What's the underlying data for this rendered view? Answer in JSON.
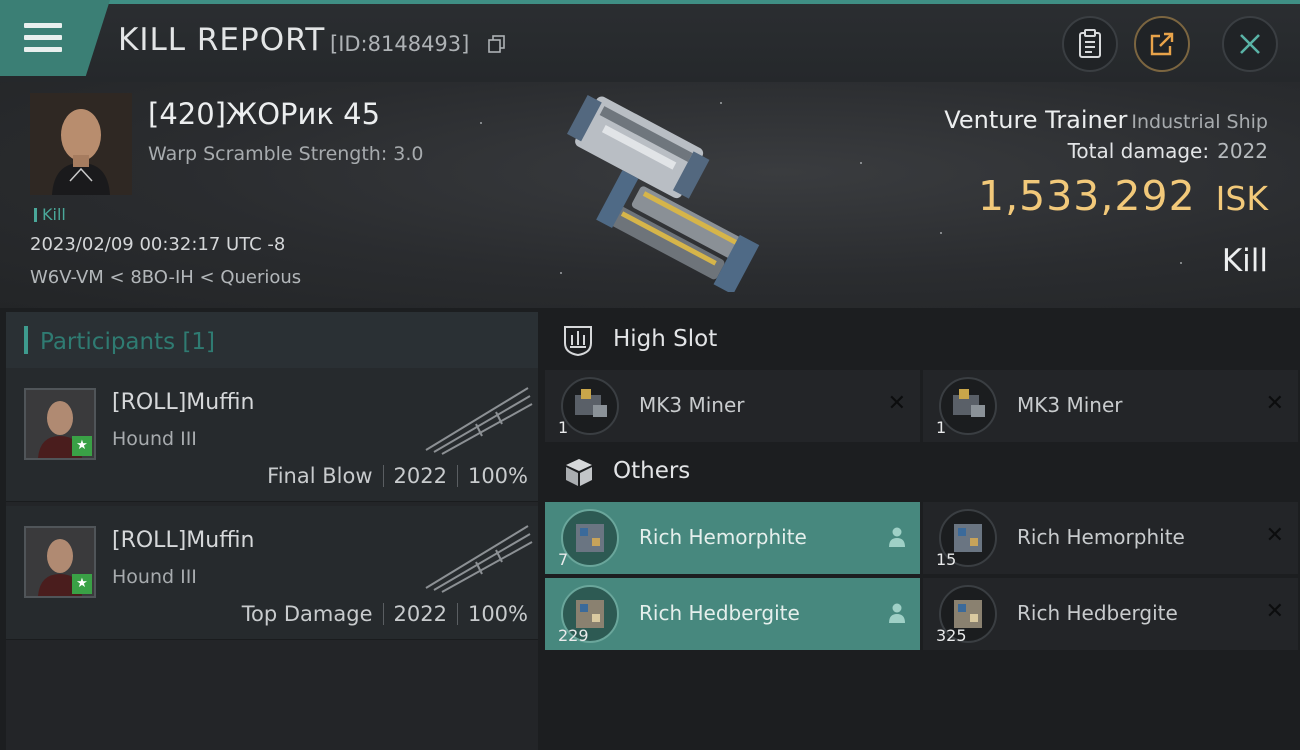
{
  "header": {
    "title": "KILL REPORT",
    "report_id": "[ID:8148493]"
  },
  "victim": {
    "name": "[420]ЖОРик 45",
    "warp_scramble": "Warp Scramble Strength: 3.0",
    "tag": "Kill",
    "datetime": "2023/02/09 00:32:17 UTC -8",
    "route": "W6V-VM < 8BO-IH < Querious"
  },
  "ship": {
    "name": "Venture Trainer",
    "class": "Industrial Ship",
    "total_damage_label": "Total damage:",
    "total_damage": "2022",
    "isk_value": "1,533,292",
    "isk_unit": "ISK",
    "result": "Kill"
  },
  "participants": {
    "title": "Participants [1]",
    "rows": [
      {
        "name": "[ROLL]Muffin",
        "ship": "Hound III",
        "role": "Final Blow",
        "damage": "2022",
        "percent": "100%"
      },
      {
        "name": "[ROLL]Muffin",
        "ship": "Hound III",
        "role": "Top Damage",
        "damage": "2022",
        "percent": "100%"
      }
    ]
  },
  "high_slot": {
    "label": "High Slot",
    "items": [
      {
        "name": "MK3 Miner",
        "qty": "1",
        "status": "destroyed"
      },
      {
        "name": "MK3 Miner",
        "qty": "1",
        "status": "destroyed"
      }
    ]
  },
  "others": {
    "label": "Others",
    "items": [
      {
        "name": "Rich Hemorphite",
        "qty": "7",
        "status": "dropped"
      },
      {
        "name": "Rich Hemorphite",
        "qty": "15",
        "status": "destroyed"
      },
      {
        "name": "Rich Hedbergite",
        "qty": "229",
        "status": "dropped"
      },
      {
        "name": "Rich Hedbergite",
        "qty": "325",
        "status": "destroyed"
      }
    ]
  },
  "colors": {
    "accent": "#3f8f84",
    "isk": "#f2c97a",
    "dropped_highlight": "#47887e"
  },
  "icons": {
    "menu": "hamburger-icon",
    "copy": "copy-icon",
    "clipboard": "clipboard-icon",
    "share": "share-icon",
    "close": "close-icon",
    "high_slot": "high-slot-icon",
    "others": "cube-icon",
    "destroyed": "x-icon",
    "dropped": "person-icon"
  }
}
